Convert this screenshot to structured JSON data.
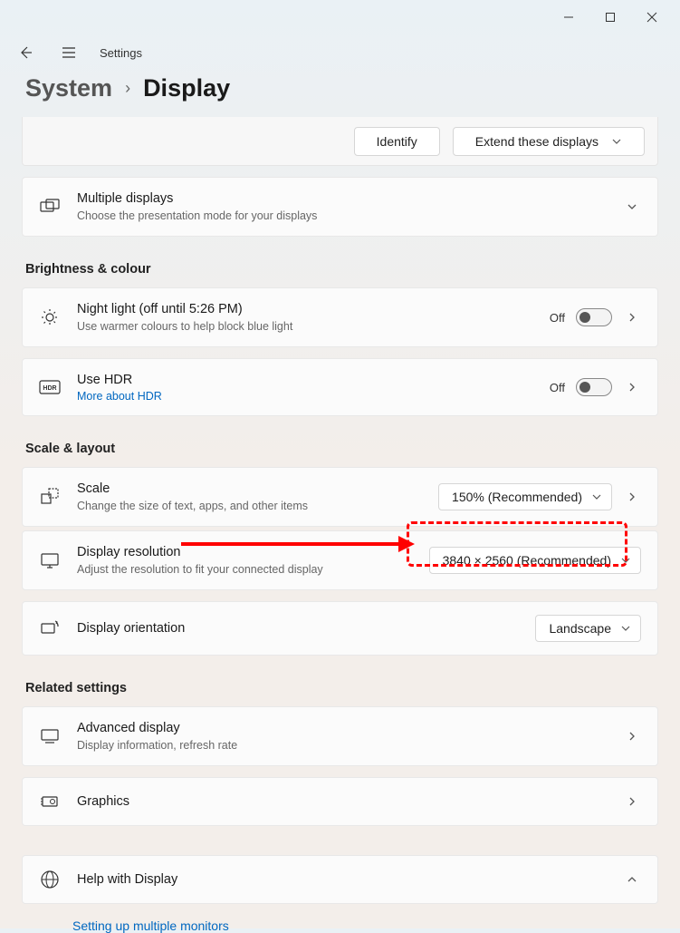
{
  "topbar": {
    "title": "Settings"
  },
  "breadcrumb": {
    "system": "System",
    "display": "Display"
  },
  "topbox": {
    "identify": "Identify",
    "extend": "Extend these displays"
  },
  "multiDisplay": {
    "title": "Multiple displays",
    "sub": "Choose the presentation mode for your displays"
  },
  "sections": {
    "brightness": "Brightness & colour",
    "scale": "Scale & layout",
    "related": "Related settings"
  },
  "nightLight": {
    "title": "Night light (off until 5:26 PM)",
    "sub": "Use warmer colours to help block blue light",
    "state": "Off"
  },
  "hdr": {
    "title": "Use HDR",
    "link": "More about HDR",
    "state": "Off"
  },
  "scale": {
    "title": "Scale",
    "sub": "Change the size of text, apps, and other items",
    "value": "150% (Recommended)"
  },
  "resolution": {
    "title": "Display resolution",
    "sub": "Adjust the resolution to fit your connected display",
    "value": "3840 × 2560 (Recommended)"
  },
  "orientation": {
    "title": "Display orientation",
    "value": "Landscape"
  },
  "advanced": {
    "title": "Advanced display",
    "sub": "Display information, refresh rate"
  },
  "graphics": {
    "title": "Graphics"
  },
  "help": {
    "title": "Help with Display",
    "link1": "Setting up multiple monitors"
  }
}
